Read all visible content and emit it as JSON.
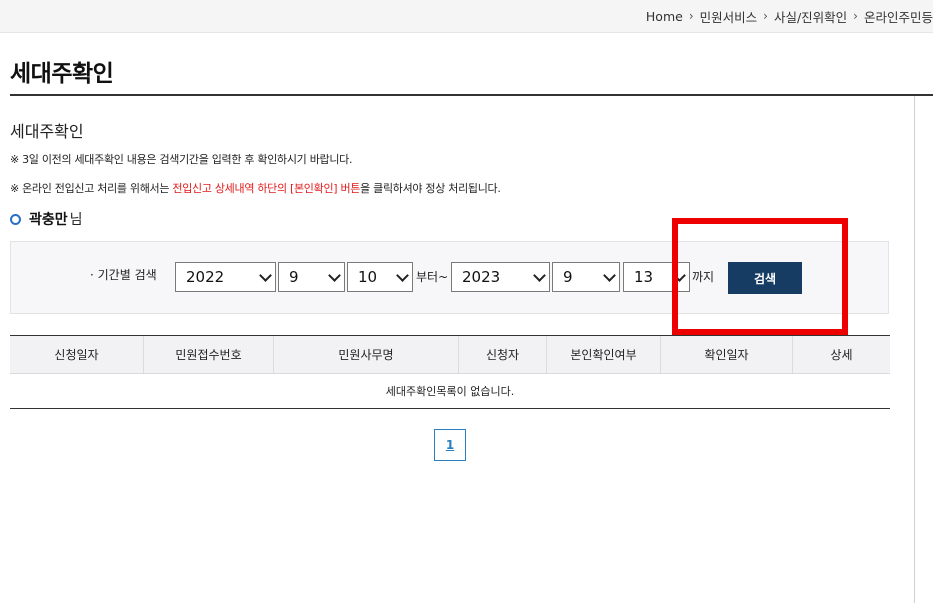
{
  "breadcrumb": {
    "items": [
      "Home",
      "민원서비스",
      "사실/진위확인",
      "온라인주민등"
    ],
    "separator": "›"
  },
  "page": {
    "title": "세대주확인",
    "subtitle": "세대주확인"
  },
  "notices": {
    "line1": "※ 3일 이전의 세대주확인 내용은 검색기간을 입력한 후 확인하시기 바랍니다.",
    "line2_prefix": "※ 온라인 전입신고 처리를 위해서는 ",
    "line2_red": "전입신고 상세내역 하단의 [본인확인] 버튼",
    "line2_suffix": "을 클릭하셔야 정상 처리됩니다."
  },
  "user": {
    "name": "곽충만",
    "suffix": "님"
  },
  "search": {
    "label": "· 기간별 검색",
    "from_year": "2022",
    "from_month": "9",
    "from_day": "10",
    "from_text": "부터~",
    "to_year": "2023",
    "to_month": "9",
    "to_day": "13",
    "to_text": "까지",
    "button_label": "검색"
  },
  "table": {
    "headers": [
      "신청일자",
      "민원접수번호",
      "민원사무명",
      "신청자",
      "본인확인여부",
      "확인일자",
      "상세"
    ],
    "empty_message": "세대주확인목록이 없습니다."
  },
  "pagination": {
    "pages": [
      "1"
    ]
  },
  "colors": {
    "accent": "#173c63",
    "highlight": "#ee0000",
    "notice_red": "#e21a1a",
    "page_link": "#2a7fbf"
  }
}
